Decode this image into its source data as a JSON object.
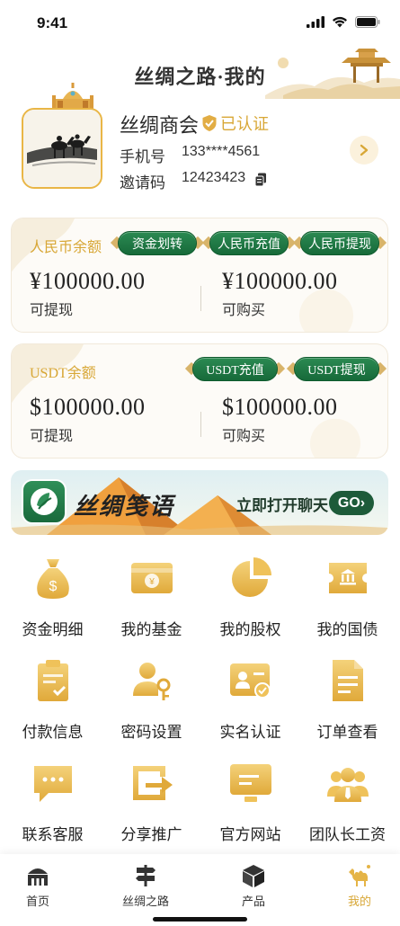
{
  "status_bar": {
    "time": "9:41"
  },
  "header": {
    "title": "丝绸之路·我的"
  },
  "profile": {
    "name": "丝绸商会",
    "verified_label": "已认证",
    "phone_label": "手机号",
    "phone_value": "133****4561",
    "invite_label": "邀请码",
    "invite_value": "12423423"
  },
  "rmb_card": {
    "label": "人民币余额",
    "buttons": [
      "资金划转",
      "人民币充值",
      "人民币提现"
    ],
    "left_amount": "¥100000.00",
    "left_sub": "可提现",
    "right_amount": "¥100000.00",
    "right_sub": "可购买"
  },
  "usdt_card": {
    "label": "USDT余额",
    "buttons": [
      "USDT充值",
      "USDT提现"
    ],
    "left_amount": "$100000.00",
    "left_sub": "可提现",
    "right_amount": "$100000.00",
    "right_sub": "可购买"
  },
  "banner": {
    "title": "丝绸笺语",
    "cta": "立即打开聊天",
    "go": "GO›"
  },
  "menu": [
    {
      "label": "资金明细",
      "icon": "money-bag-icon"
    },
    {
      "label": "我的基金",
      "icon": "fund-icon"
    },
    {
      "label": "我的股权",
      "icon": "pie-chart-icon"
    },
    {
      "label": "我的国债",
      "icon": "bond-icon"
    },
    {
      "label": "付款信息",
      "icon": "clipboard-icon"
    },
    {
      "label": "密码设置",
      "icon": "user-key-icon"
    },
    {
      "label": "实名认证",
      "icon": "id-card-icon"
    },
    {
      "label": "订单查看",
      "icon": "document-icon"
    },
    {
      "label": "联系客服",
      "icon": "chat-icon"
    },
    {
      "label": "分享推广",
      "icon": "share-icon"
    },
    {
      "label": "官方网站",
      "icon": "monitor-icon"
    },
    {
      "label": "团队长工资",
      "icon": "team-icon"
    }
  ],
  "tabbar": {
    "items": [
      {
        "label": "首页",
        "icon": "home-icon"
      },
      {
        "label": "丝绸之路",
        "icon": "signpost-icon"
      },
      {
        "label": "产品",
        "icon": "box-icon"
      },
      {
        "label": "我的",
        "icon": "camel-icon"
      }
    ],
    "active_index": 3
  },
  "colors": {
    "gold": "#d8a736",
    "green": "#1d6d3d"
  }
}
